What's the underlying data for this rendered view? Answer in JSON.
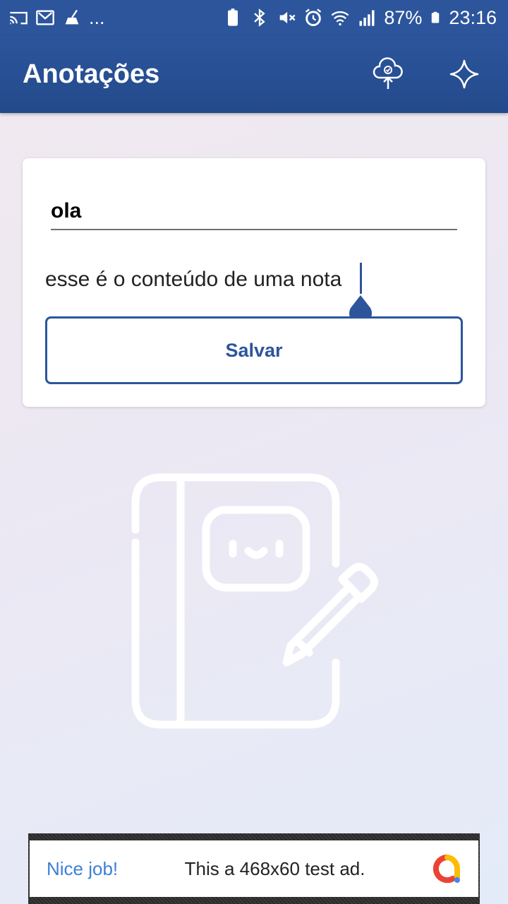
{
  "status_bar": {
    "left_icons": [
      "cast-icon",
      "gmail-icon",
      "cleaner-icon"
    ],
    "overflow": "...",
    "right_icons": [
      "battery-saver-icon",
      "bluetooth-icon",
      "mute-icon",
      "alarm-icon",
      "wifi-icon",
      "signal-icon"
    ],
    "battery_percent": "87%",
    "time": "23:16"
  },
  "app_bar": {
    "title": "Anotações",
    "actions": [
      "cloud-upload-icon",
      "sparkle-icon"
    ]
  },
  "note_form": {
    "title_value": "ola",
    "content_value": "esse é o conteúdo de uma nota",
    "save_label": "Salvar"
  },
  "illustration": {
    "icon": "notebook-pencil-icon"
  },
  "ad": {
    "headline": "Nice job!",
    "text": "This a 468x60 test ad."
  },
  "colors": {
    "primary": "#2c559c",
    "ad_link": "#3d7fd6"
  }
}
